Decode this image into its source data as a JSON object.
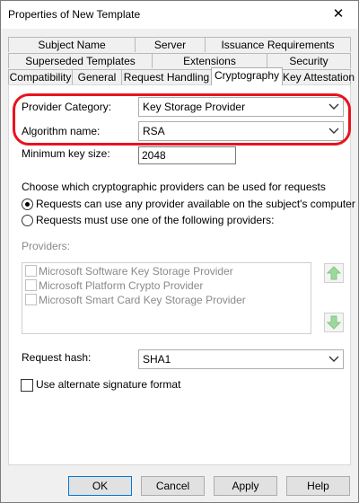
{
  "window": {
    "title": "Properties of New Template",
    "close_glyph": "✕"
  },
  "tabs": {
    "row1": [
      "Subject Name",
      "Server",
      "Issuance Requirements"
    ],
    "row2": [
      "Superseded Templates",
      "Extensions",
      "Security"
    ],
    "row3": [
      "Compatibility",
      "General",
      "Request Handling",
      "Cryptography",
      "Key Attestation"
    ],
    "active": "Cryptography"
  },
  "crypto": {
    "provider_category_label": "Provider Category:",
    "provider_category_value": "Key Storage Provider",
    "algorithm_label": "Algorithm name:",
    "algorithm_value": "RSA",
    "min_key_label": "Minimum key size:",
    "min_key_value": "2048",
    "choose_text": "Choose which cryptographic providers can be used for requests",
    "radio_any": "Requests can use any provider available on the subject's computer",
    "radio_any_selected": true,
    "radio_list": "Requests must use one of the following providers:",
    "providers_label": "Providers:",
    "providers": [
      "Microsoft Software Key Storage Provider",
      "Microsoft Platform Crypto Provider",
      "Microsoft Smart Card Key Storage Provider"
    ],
    "hash_label": "Request hash:",
    "hash_value": "SHA1",
    "alt_sig_label": "Use alternate signature format"
  },
  "buttons": {
    "ok": "OK",
    "cancel": "Cancel",
    "apply": "Apply",
    "help": "Help"
  },
  "colors": {
    "highlight": "#e8141e",
    "arrow_enabled": "#7fc97f"
  },
  "icons": {
    "up": "arrow-up-icon",
    "down": "arrow-down-icon",
    "dropdown": "chevron-down-icon"
  }
}
